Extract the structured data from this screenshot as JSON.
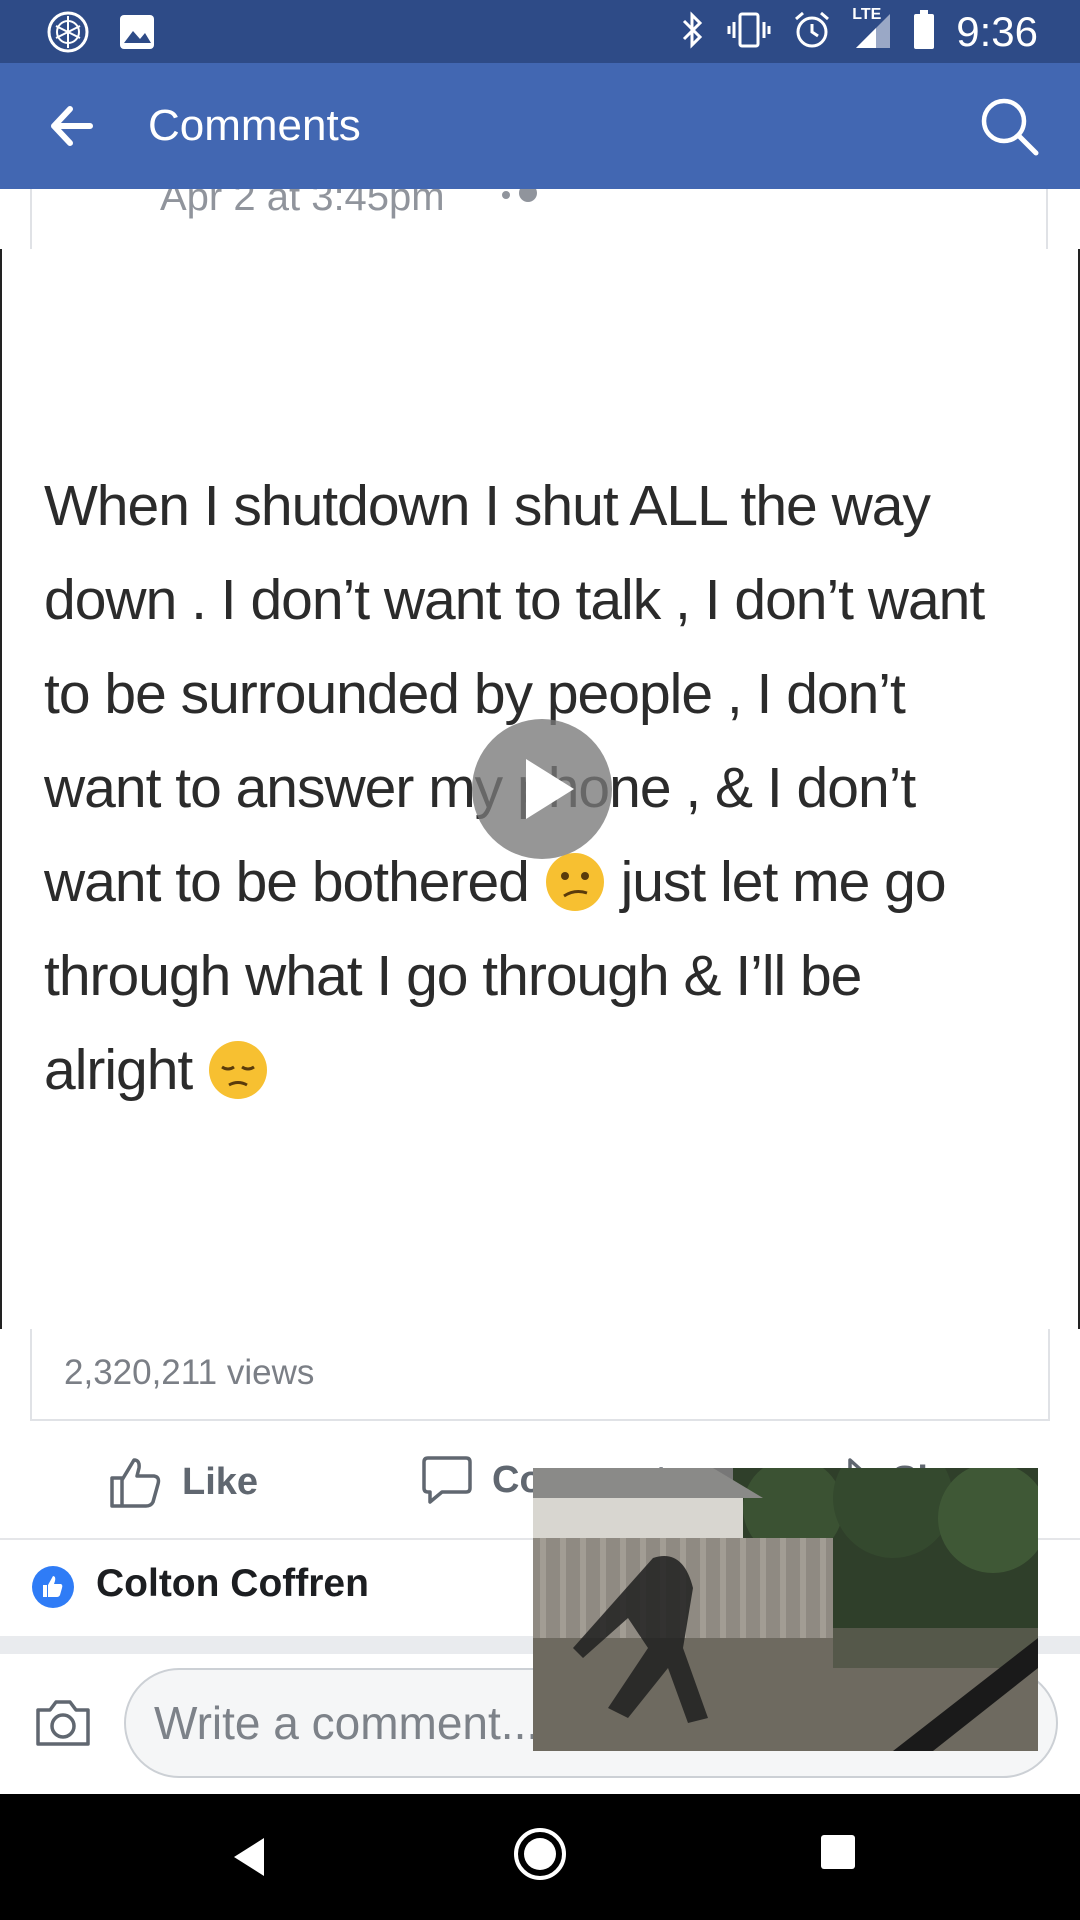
{
  "status_bar": {
    "time": "9:36",
    "network_label": "LTE",
    "icons": [
      "app-circle-icon",
      "image-icon",
      "bluetooth-icon",
      "vibrate-icon",
      "alarm-icon",
      "signal-icon",
      "battery-icon"
    ]
  },
  "app_bar": {
    "title": "Comments",
    "back_icon": "back-arrow-icon",
    "search_icon": "search-icon",
    "color": "#4267b2"
  },
  "post": {
    "date": "Apr 2 at 3:45pm",
    "quote_lines": [
      "When I shutdown I shut ALL the way",
      "down . I don’t want to talk , I don’t want",
      "to be surrounded by people , I don’t",
      "want to answer my phone , & I don’t",
      "want to be bothered",
      "just let me go",
      "through what I go through & I’ll be",
      "alright"
    ],
    "emojis": [
      "confused-face-icon",
      "pensive-face-icon"
    ],
    "views": "2,320,211 views"
  },
  "actions": {
    "like": "Like",
    "comment": "Comment",
    "share": "Share"
  },
  "reactor": {
    "name": "Colton Coffren"
  },
  "composer": {
    "placeholder": "Write a comment..."
  }
}
